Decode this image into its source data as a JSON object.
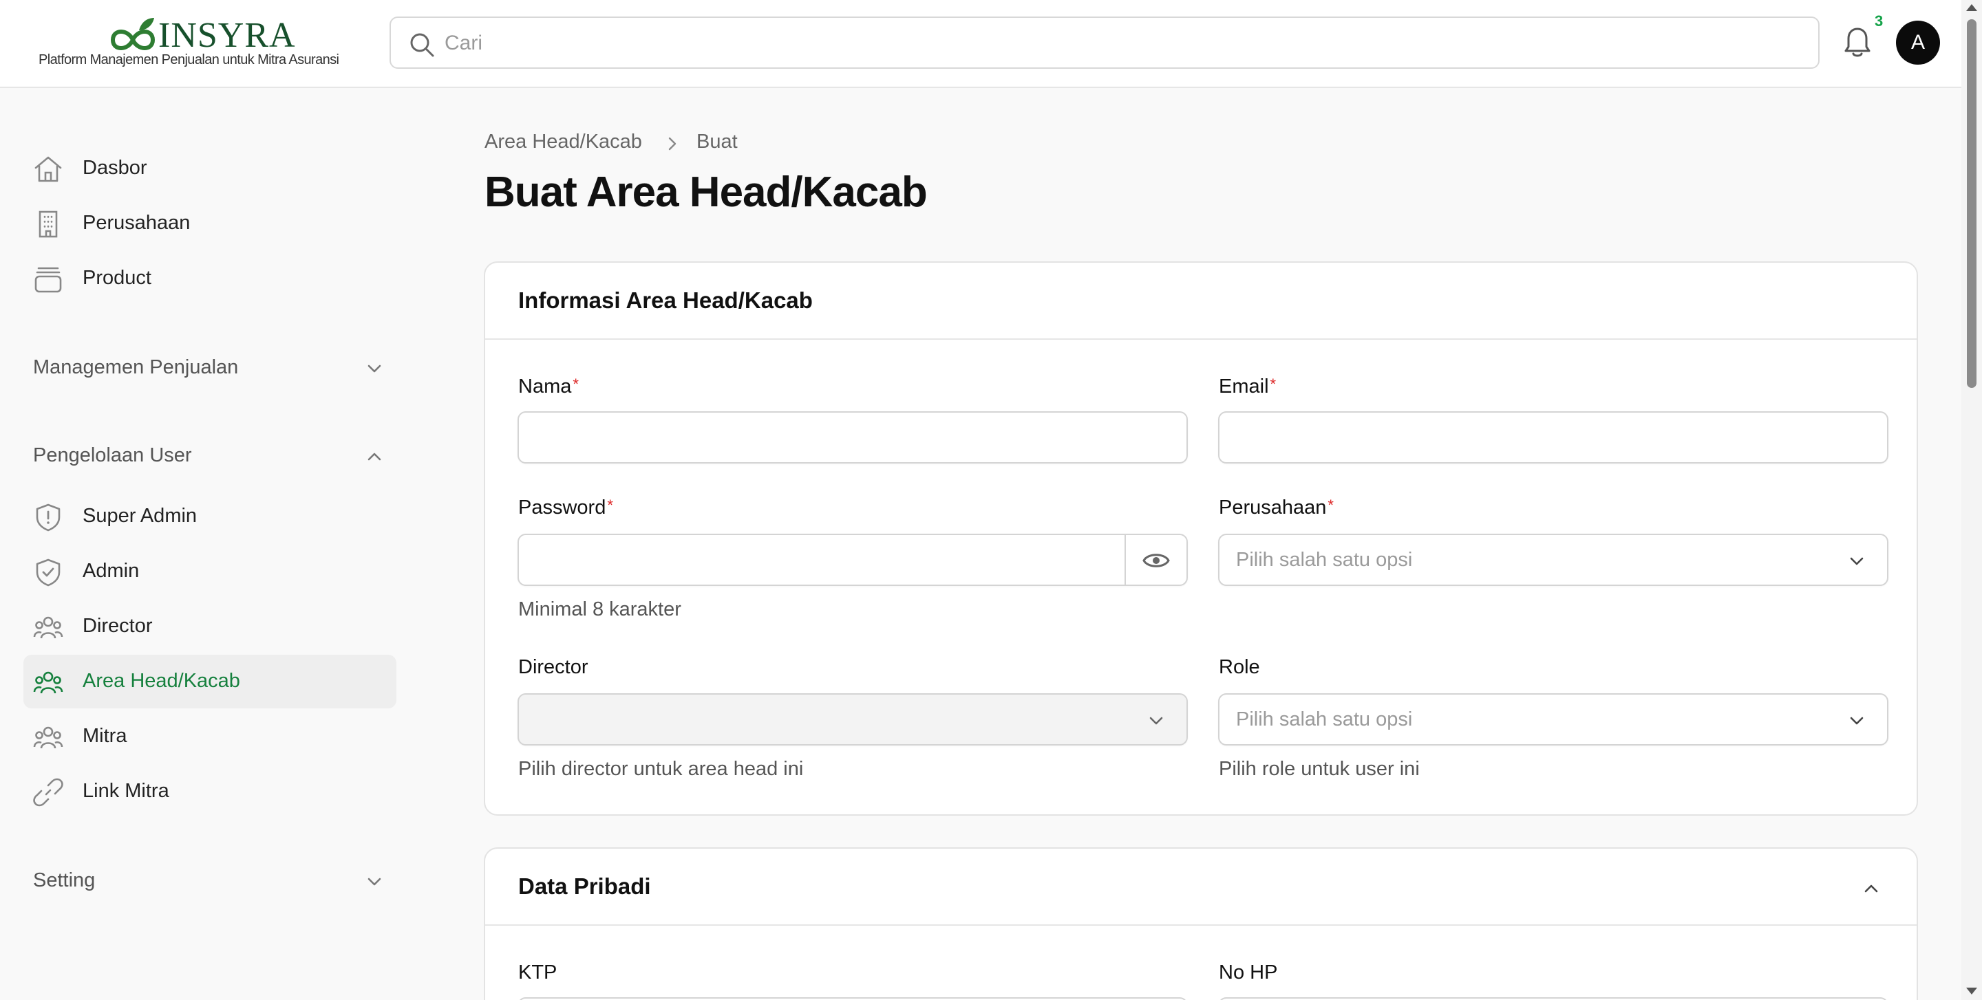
{
  "brand": {
    "name": "INSYRA",
    "tagline": "Platform Manajemen Penjualan untuk Mitra Asuransi",
    "color": "#17502c"
  },
  "header": {
    "search_placeholder": "Cari",
    "notification_count": "3",
    "avatar_initial": "A"
  },
  "sidebar": {
    "top_items": [
      {
        "label": "Dasbor",
        "icon": "home-icon"
      },
      {
        "label": "Perusahaan",
        "icon": "building-icon"
      },
      {
        "label": "Product",
        "icon": "box-icon"
      }
    ],
    "groups": {
      "sales": {
        "label": "Managemen Penjualan",
        "expanded": false
      },
      "users": {
        "label": "Pengelolaan User",
        "expanded": true
      },
      "setting": {
        "label": "Setting",
        "expanded": false
      }
    },
    "user_items": [
      {
        "label": "Super Admin",
        "icon": "shield-alert-icon"
      },
      {
        "label": "Admin",
        "icon": "shield-check-icon"
      },
      {
        "label": "Director",
        "icon": "users-icon"
      },
      {
        "label": "Area Head/Kacab",
        "icon": "users-icon",
        "active": true
      },
      {
        "label": "Mitra",
        "icon": "users-icon"
      },
      {
        "label": "Link Mitra",
        "icon": "link-icon"
      }
    ],
    "active_color": "#15803d"
  },
  "breadcrumb": {
    "parent": "Area Head/Kacab",
    "current": "Buat"
  },
  "page": {
    "title": "Buat Area Head/Kacab"
  },
  "info_card": {
    "title": "Informasi Area Head/Kacab",
    "fields": {
      "nama": {
        "label": "Nama",
        "required": "*",
        "value": ""
      },
      "email": {
        "label": "Email",
        "required": "*",
        "value": ""
      },
      "password": {
        "label": "Password",
        "required": "*",
        "value": "",
        "helper": "Minimal 8 karakter"
      },
      "perusahaan": {
        "label": "Perusahaan",
        "required": "*",
        "placeholder": "Pilih salah satu opsi"
      },
      "director": {
        "label": "Director",
        "value": "",
        "helper": "Pilih director untuk area head ini"
      },
      "role": {
        "label": "Role",
        "placeholder": "Pilih salah satu opsi",
        "helper": "Pilih role untuk user ini"
      }
    }
  },
  "personal_card": {
    "title": "Data Pribadi",
    "fields": {
      "ktp": {
        "label": "KTP"
      },
      "no_hp": {
        "label": "No HP"
      }
    }
  }
}
